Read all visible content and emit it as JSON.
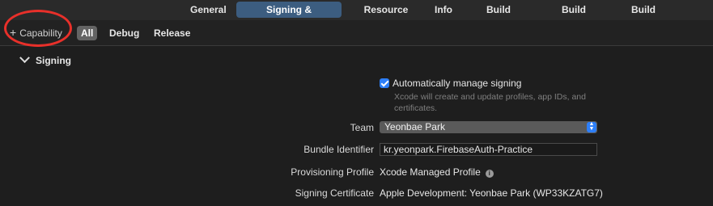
{
  "tabs": [
    {
      "label": "General",
      "active": false
    },
    {
      "label": "Signing & Capabilities",
      "active": true
    },
    {
      "label": "Resource Tags",
      "active": false
    },
    {
      "label": "Info",
      "active": false
    },
    {
      "label": "Build Settings",
      "active": false
    },
    {
      "label": "Build Phases",
      "active": false
    },
    {
      "label": "Build Rules",
      "active": false
    }
  ],
  "toolbar": {
    "add_capability_label": "Capability",
    "add_icon": "plus-icon",
    "filters": [
      {
        "label": "All",
        "active": true
      },
      {
        "label": "Debug",
        "active": false
      },
      {
        "label": "Release",
        "active": false
      }
    ]
  },
  "signing": {
    "section_title": "Signing",
    "auto_manage": {
      "checked": true,
      "label": "Automatically manage signing",
      "description": "Xcode will create and update profiles, app IDs, and certificates."
    },
    "team": {
      "label": "Team",
      "value": "Yeonbae Park"
    },
    "bundle_identifier": {
      "label": "Bundle Identifier",
      "value": "kr.yeonpark.FirebaseAuth-Practice"
    },
    "provisioning_profile": {
      "label": "Provisioning Profile",
      "value": "Xcode Managed Profile",
      "icon": "info-icon"
    },
    "signing_certificate": {
      "label": "Signing Certificate",
      "value": "Apple Development: Yeonbae Park (WP33KZATG7)"
    }
  },
  "colors": {
    "background": "#1e1e1e",
    "active_tab": "#3c5d80",
    "accent": "#2d7ff9",
    "annotation": "#e8302a"
  }
}
